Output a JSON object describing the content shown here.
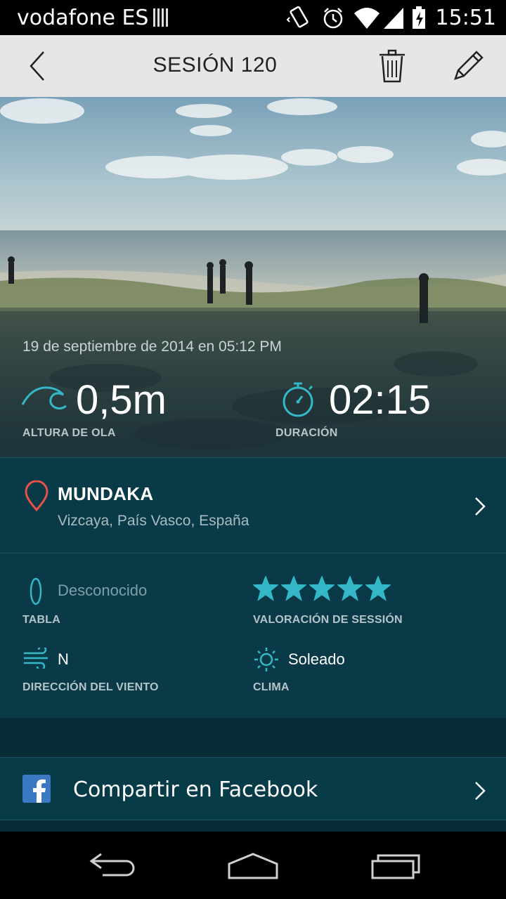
{
  "status_bar": {
    "carrier": "vodafone ES",
    "time": "15:51",
    "icons": [
      "sim-card-icon",
      "vibrate-icon",
      "alarm-icon",
      "wifi-icon",
      "signal-icon",
      "battery-charging-icon"
    ]
  },
  "toolbar": {
    "title": "SESIÓN 120",
    "icons": [
      "back-arrow-icon",
      "trash-icon",
      "edit-pencil-icon"
    ]
  },
  "session": {
    "date": "19 de septiembre de 2014 en 05:12 PM",
    "wave_height": "0,5m",
    "wave_height_label": "ALTURA DE OLA",
    "duration": "02:15",
    "duration_label": "DURACIÓN"
  },
  "location": {
    "name": "MUNDAKA",
    "region": "Vizcaya, País Vasco, España"
  },
  "details": {
    "board_value": "Desconocido",
    "board_label": "TABLA",
    "rating_label": "VALORACIÓN DE SESSIÓN",
    "rating": 5,
    "rating_max": 5,
    "wind_value": "N",
    "wind_label": "DIRECCIÓN DEL VIENTO",
    "weather_value": "Soleado",
    "weather_label": "CLIMA"
  },
  "share": {
    "facebook_label": "Compartir en Facebook"
  },
  "colors": {
    "accent": "#34b8c8",
    "panel": "#0a3a47",
    "pin": "#e8504a",
    "facebook": "#3b78c2"
  }
}
